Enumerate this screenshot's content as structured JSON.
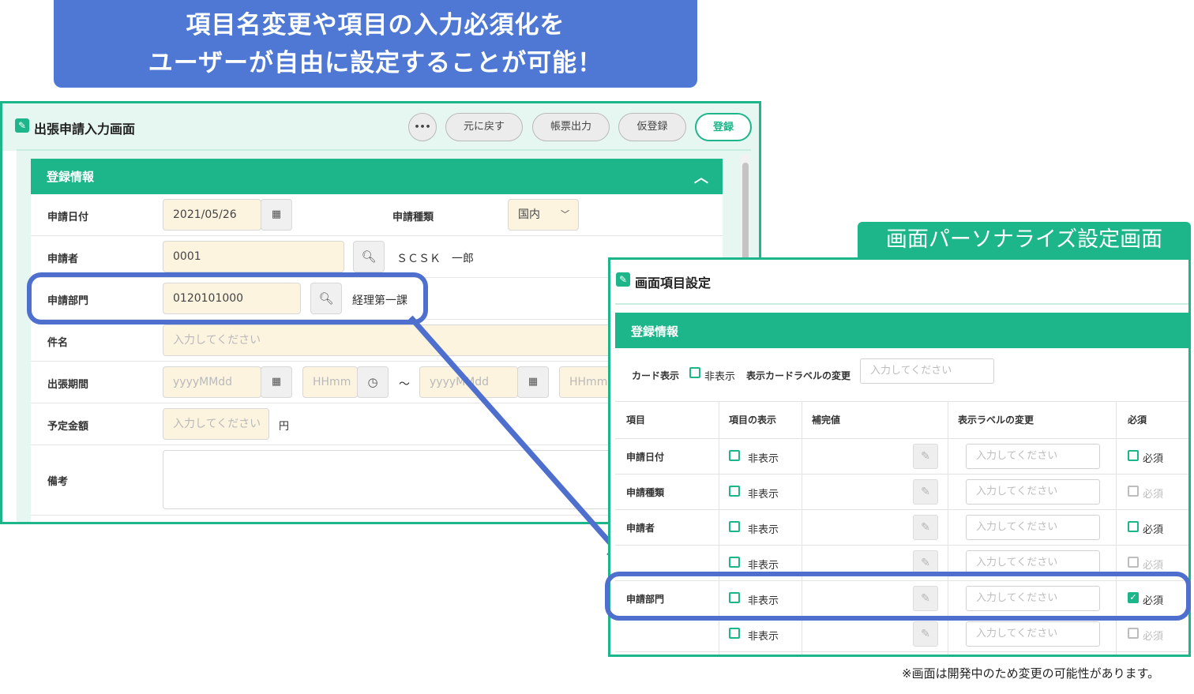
{
  "banner": {
    "line1": "項目名変更や項目の入力必須化を",
    "line2": "ユーザーが自由に設定することが可能！"
  },
  "form": {
    "title": "出張申請入力画面",
    "toolbar": {
      "more_label": "•••",
      "revert_label": "元に戻す",
      "print_label": "帳票出力",
      "draft_label": "仮登録",
      "register_label": "登録"
    },
    "section_title": "登録情報",
    "fields": {
      "apply_date_label": "申請日付",
      "apply_date_value": "2021/05/26",
      "apply_type_label": "申請種類",
      "apply_type_value": "国内",
      "applicant_label": "申請者",
      "applicant_value": "0001",
      "applicant_name": "ＳＣＳＫ　一郎",
      "dept_label": "申請部門",
      "dept_value": "0120101000",
      "dept_name": "経理第一課",
      "subject_label": "件名",
      "subject_placeholder": "入力してください",
      "period_label": "出張期間",
      "date_placeholder": "yyyyMMdd",
      "time_placeholder": "HHmm",
      "tilde": "～",
      "amount_label": "予定金額",
      "amount_placeholder": "入力してください",
      "amount_unit": "円",
      "notes_label": "備考"
    }
  },
  "personalize": {
    "tab_label": "画面パーソナライズ設定画面",
    "title": "画面項目設定",
    "section_title": "登録情報",
    "card_display_label": "カード表示",
    "hide_label": "非表示",
    "card_label_change": "表示カードラベルの変更",
    "input_placeholder": "入力してください",
    "columns": [
      "項目",
      "項目の表示",
      "補完値",
      "表示ラベルの変更",
      "必須"
    ],
    "rows": [
      {
        "item": "申請日付",
        "hide": "非表示",
        "placeholder": "入力してください",
        "required": "必須",
        "required_enabled": true,
        "required_checked": false
      },
      {
        "item": "申請種類",
        "hide": "非表示",
        "placeholder": "入力してください",
        "required": "必須",
        "required_enabled": false,
        "required_checked": false
      },
      {
        "item": "申請者",
        "hide": "非表示",
        "placeholder": "入力してください",
        "required": "必須",
        "required_enabled": true,
        "required_checked": false
      },
      {
        "item": "",
        "hide": "非表示",
        "placeholder": "入力してください",
        "required": "必須",
        "required_enabled": false,
        "required_checked": false
      },
      {
        "item": "申請部門",
        "hide": "非表示",
        "placeholder": "入力してください",
        "required": "必須",
        "required_enabled": true,
        "required_checked": true
      },
      {
        "item": "",
        "hide": "非表示",
        "placeholder": "入力してください",
        "required": "必須",
        "required_enabled": false,
        "required_checked": false
      }
    ]
  },
  "footnote": "※画面は開発中のため変更の可能性があります。",
  "colors": {
    "brand_green": "#1db68a",
    "banner_blue": "#4f78d4",
    "highlight_blue": "#4f6fcf",
    "input_fill": "#fdf4e0"
  }
}
